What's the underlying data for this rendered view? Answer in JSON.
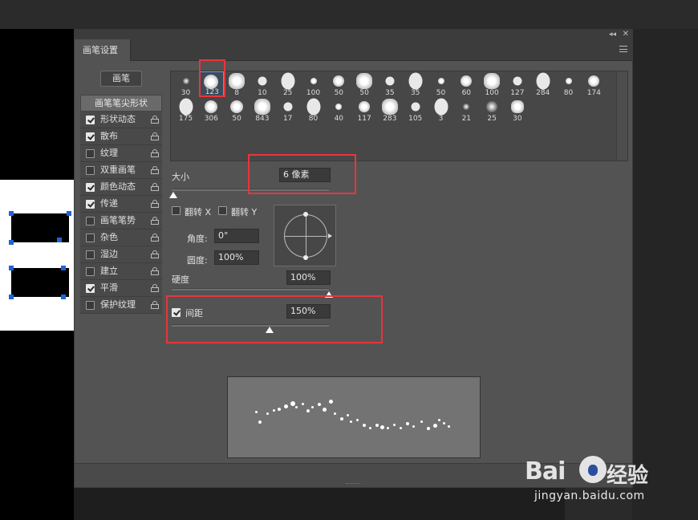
{
  "window": {
    "collapse_glyph": "◂◂",
    "close_glyph": "✕"
  },
  "tab": {
    "label": "画笔设置"
  },
  "brush_button": {
    "label": "画笔"
  },
  "settings": {
    "header": "画笔笔尖形状",
    "items": [
      {
        "label": "形状动态",
        "checked": true
      },
      {
        "label": "散布",
        "checked": true
      },
      {
        "label": "纹理",
        "checked": false
      },
      {
        "label": "双重画笔",
        "checked": false
      },
      {
        "label": "颜色动态",
        "checked": true
      },
      {
        "label": "传递",
        "checked": true
      },
      {
        "label": "画笔笔势",
        "checked": false
      },
      {
        "label": "杂色",
        "checked": false
      },
      {
        "label": "湿边",
        "checked": false
      },
      {
        "label": "建立",
        "checked": false
      },
      {
        "label": "平滑",
        "checked": true
      },
      {
        "label": "保护纹理",
        "checked": false
      }
    ]
  },
  "brushes": {
    "row1": [
      "30",
      "123",
      "8",
      "10",
      "25",
      "100",
      "50",
      "50",
      "35",
      "35",
      "50",
      "60",
      "100",
      "127",
      "284",
      "80",
      "174"
    ],
    "row2": [
      "175",
      "306",
      "50",
      "843",
      "17",
      "80",
      "40",
      "117",
      "283",
      "105",
      "3",
      "21",
      "25",
      "30"
    ],
    "selected": "123"
  },
  "size": {
    "label": "大小",
    "value": "6 像素",
    "level_percent": 1
  },
  "flip_x": {
    "label": "翻转 X",
    "checked": false
  },
  "flip_y": {
    "label": "翻转 Y",
    "checked": false
  },
  "angle": {
    "label": "角度:",
    "value": "0°"
  },
  "roundness": {
    "label": "圆度:",
    "value": "100%"
  },
  "hardness": {
    "label": "硬度",
    "value": "100%",
    "level_percent": 100
  },
  "spacing": {
    "label": "间距",
    "value": "150%",
    "checked": true,
    "level_percent": 62
  },
  "watermark": {
    "brand": "Bai",
    "brand_tail": "经验",
    "url": "jingyan.baidu.com"
  }
}
